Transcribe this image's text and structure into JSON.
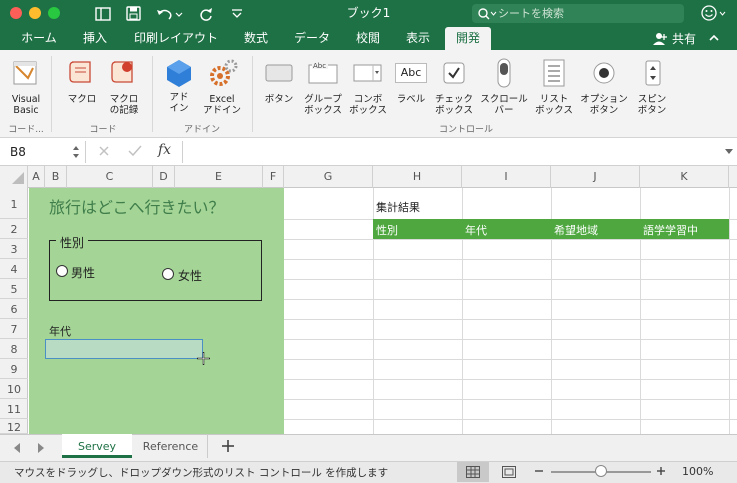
{
  "app": {
    "doc_title": "ブック1",
    "search_placeholder": "シートを検索",
    "share_label": "共有"
  },
  "tabs": [
    "ホーム",
    "挿入",
    "印刷レイアウト",
    "数式",
    "データ",
    "校閲",
    "表示",
    "開発"
  ],
  "active_tab": "開発",
  "ribbon": {
    "code_group": {
      "visual_basic": "Visual\nBasic",
      "macro": "マクロ",
      "record_macro": "マクロ\nの記録",
      "label_short": "コード...",
      "label": "コード"
    },
    "addin_group": {
      "addin": "アド\nイン",
      "excel_addin": "Excel\nアドイン",
      "label": "アドイン"
    },
    "controls_group": {
      "button": "ボタン",
      "group_box": "グループ\nボックス",
      "combo_box": "コンボ\nボックス",
      "label_ctrl": "ラベル",
      "check_box": "チェック\nボックス",
      "scroll_bar": "スクロール\nバー",
      "list_box": "リスト\nボックス",
      "option_button": "オプション\nボタン",
      "spin_button": "スピン\nボタン",
      "label": "コントロール",
      "abc1": "Abc",
      "abc2": "Abc"
    }
  },
  "formula_bar": {
    "name_box": "B8",
    "fx": "fx",
    "formula": ""
  },
  "columns": [
    "A",
    "B",
    "C",
    "D",
    "E",
    "F",
    "G",
    "H",
    "I",
    "J",
    "K"
  ],
  "rows": [
    "1",
    "2",
    "3",
    "4",
    "5",
    "6",
    "7",
    "8",
    "9",
    "10",
    "11",
    "12"
  ],
  "form": {
    "title": "旅行はどこへ行きたい？",
    "gender_group_label": "性別",
    "male": "男性",
    "female": "女性",
    "age_label": "年代"
  },
  "results": {
    "title": "集計結果",
    "headers": [
      "性別",
      "年代",
      "希望地域",
      "語学学習中"
    ]
  },
  "sheets": [
    "Servey",
    "Reference"
  ],
  "active_sheet": "Servey",
  "status": {
    "message": "マウスをドラッグし、ドロップダウン形式のリスト コントロール を作成します",
    "zoom": "100%",
    "zoom_level": 0.5
  },
  "colors": {
    "excel_green": "#1e7145",
    "form_bg": "#a4d596",
    "header_green": "#4ea73f"
  }
}
